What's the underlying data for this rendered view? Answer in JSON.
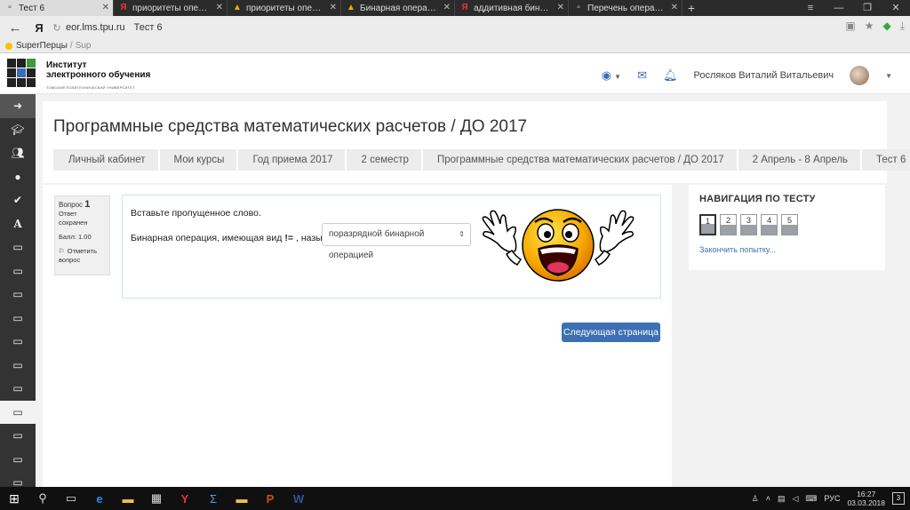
{
  "browser": {
    "tabs": [
      {
        "title": "Тест 6",
        "icon": "page-icon",
        "active": true
      },
      {
        "title": "приоритеты операций в вы",
        "icon": "yandex-icon",
        "active": false
      },
      {
        "title": "приоритеты операций в вы",
        "icon": "image-icon",
        "active": false
      },
      {
        "title": "Бинарная операция, имею",
        "icon": "image-icon",
        "active": false
      },
      {
        "title": "аддитивная бинарная опер",
        "icon": "yandex-icon",
        "active": false
      },
      {
        "title": "Перечень операций",
        "icon": "page-icon",
        "active": false
      }
    ],
    "new_tab": "+",
    "url": "eor.lms.tpu.ru",
    "page_title": "Тест 6",
    "yandex_letter": "Я",
    "bookmark_label": "SuperПерцы",
    "bookmark_extra": "Sup"
  },
  "site": {
    "org_line1": "Институт",
    "org_line2": "электронного обучения",
    "org_line3": "ТОМСКИЙ ПОЛИТЕХНИЧЕСКИЙ УНИВЕРСИТЕТ",
    "user_name": "Росляков Виталий Витальевич"
  },
  "page": {
    "title": "Программные средства математических расчетов / ДО 2017",
    "breadcrumb": [
      "Личный кабинет",
      "Мои курсы",
      "Год приема 2017",
      "2 семестр",
      "Программные средства математических расчетов / ДО 2017",
      "2 Апрель - 8 Апрель",
      "Тест 6"
    ]
  },
  "question": {
    "label": "Вопрос",
    "number": "1",
    "state_line1": "Ответ",
    "state_line2": "сохранен",
    "mark": "Балл: 1.00",
    "flag_line1": "Отметить",
    "flag_line2": "вопрос",
    "prompt": "Вставьте пропущенное слово.",
    "text_before": "Бинарная операция, имеющая вид",
    "operator": "!=",
    "text_after": ", называется",
    "selected_answer": "поразрядной бинарной операцией"
  },
  "next_button": "Следующая страница",
  "quiz_nav": {
    "title": "НАВИГАЦИЯ ПО ТЕСТУ",
    "buttons": [
      "1",
      "2",
      "3",
      "4",
      "5"
    ],
    "current": 1,
    "finish_link": "Закончить попытку..."
  },
  "taskbar": {
    "lang": "РУС",
    "time": "16:27",
    "date": "03.03.2018",
    "notifications": "3"
  },
  "colors": {
    "primary_button": "#3c70b3",
    "sidebar": "#333333",
    "link": "#3c70b3"
  }
}
